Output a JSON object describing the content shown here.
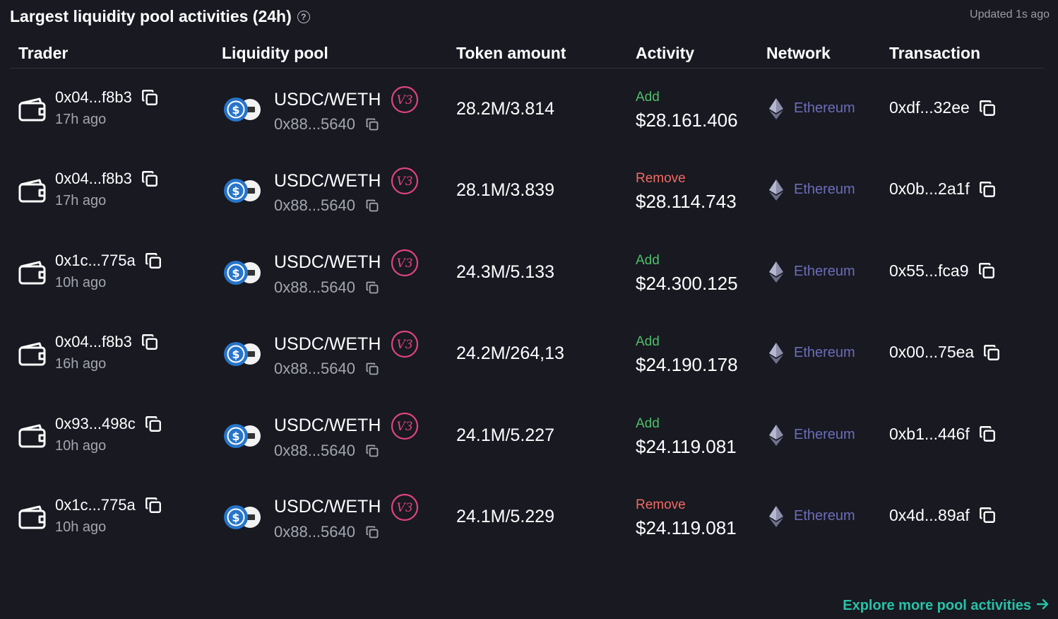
{
  "header": {
    "title": "Largest liquidity pool activities (24h)",
    "updated": "Updated 1s ago"
  },
  "columns": [
    "Trader",
    "Liquidity pool",
    "Token amount",
    "Activity",
    "Network",
    "Transaction"
  ],
  "rows": [
    {
      "trader": "0x04...f8b3",
      "time": "17h ago",
      "pool": "USDC/WETH",
      "pool_addr": "0x88...5640",
      "amount": "28.2M/3.814",
      "activity": "Add",
      "value": "$28.161.406",
      "network": "Ethereum",
      "tx": "0xdf...32ee"
    },
    {
      "trader": "0x04...f8b3",
      "time": "17h ago",
      "pool": "USDC/WETH",
      "pool_addr": "0x88...5640",
      "amount": "28.1M/3.839",
      "activity": "Remove",
      "value": "$28.114.743",
      "network": "Ethereum",
      "tx": "0x0b...2a1f"
    },
    {
      "trader": "0x1c...775a",
      "time": "10h ago",
      "pool": "USDC/WETH",
      "pool_addr": "0x88...5640",
      "amount": "24.3M/5.133",
      "activity": "Add",
      "value": "$24.300.125",
      "network": "Ethereum",
      "tx": "0x55...fca9"
    },
    {
      "trader": "0x04...f8b3",
      "time": "16h ago",
      "pool": "USDC/WETH",
      "pool_addr": "0x88...5640",
      "amount": "24.2M/264,13",
      "activity": "Add",
      "value": "$24.190.178",
      "network": "Ethereum",
      "tx": "0x00...75ea"
    },
    {
      "trader": "0x93...498c",
      "time": "10h ago",
      "pool": "USDC/WETH",
      "pool_addr": "0x88...5640",
      "amount": "24.1M/5.227",
      "activity": "Add",
      "value": "$24.119.081",
      "network": "Ethereum",
      "tx": "0xb1...446f"
    },
    {
      "trader": "0x1c...775a",
      "time": "10h ago",
      "pool": "USDC/WETH",
      "pool_addr": "0x88...5640",
      "amount": "24.1M/5.229",
      "activity": "Remove",
      "value": "$24.119.081",
      "network": "Ethereum",
      "tx": "0x4d...89af"
    }
  ],
  "footer": {
    "explore_label": "Explore more pool activities"
  },
  "icons": {
    "wallet": "wallet-icon",
    "copy": "copy-icon",
    "usdc": "usdc-icon",
    "weth": "weth-icon",
    "uniswap_v3": "v3-badge-icon",
    "ethereum": "ethereum-icon",
    "help": "help-icon",
    "arrow": "arrow-right-icon"
  },
  "colors": {
    "background": "#181921",
    "add": "#4fbf6a",
    "remove": "#f26a62",
    "network": "#6b6db8",
    "link": "#28c1a7",
    "v3_badge": "#e0457b",
    "usdc": "#2775ca"
  }
}
